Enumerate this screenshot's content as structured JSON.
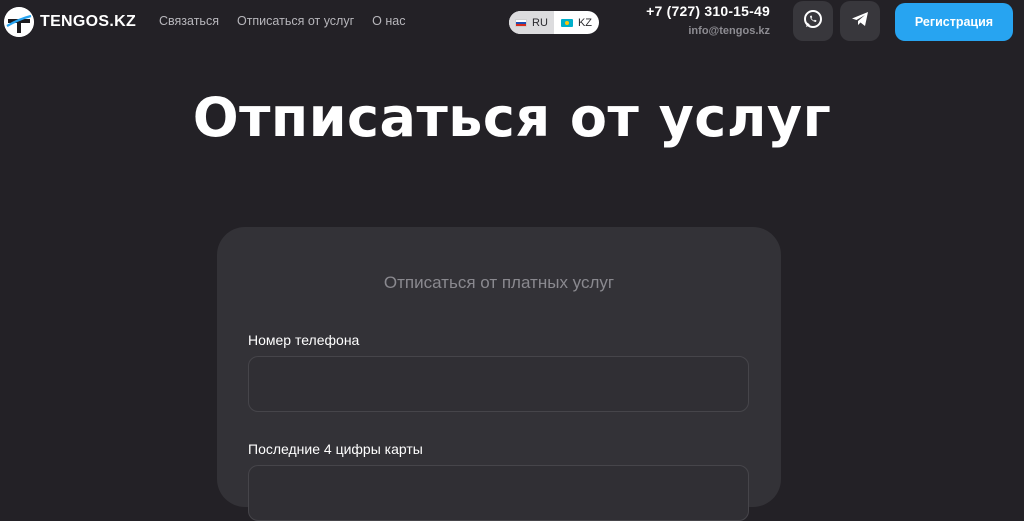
{
  "header": {
    "logo_text": "TENGOS.KZ",
    "nav": [
      {
        "label": "Связаться"
      },
      {
        "label": "Отписаться от услуг"
      },
      {
        "label": "О нас"
      }
    ],
    "languages": [
      {
        "code": "RU",
        "flag": "flag-ru-icon",
        "active": true
      },
      {
        "code": "KZ",
        "flag": "flag-kz-icon",
        "active": false
      }
    ],
    "phone": "+7 (727) 310-15-49",
    "email": "info@tengos.kz",
    "social": [
      "whatsapp-icon",
      "telegram-icon"
    ],
    "register_label": "Регистрация"
  },
  "main": {
    "title": "Отписаться от услуг",
    "form": {
      "title": "Отписаться от платных услуг",
      "phone_label": "Номер телефона",
      "phone_value": "",
      "card_label": "Последние 4 цифры карты",
      "card_value": ""
    }
  },
  "colors": {
    "background": "#232126",
    "card": "#333237",
    "accent": "#27a4f1"
  }
}
